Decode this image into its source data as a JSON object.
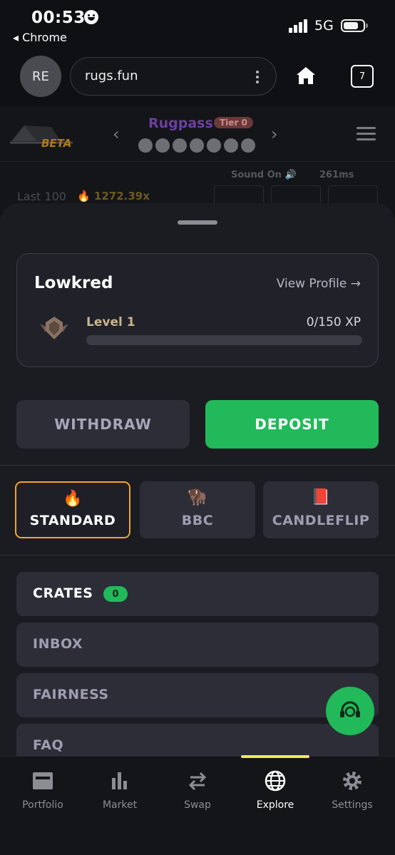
{
  "status_bar": {
    "time": "00:53",
    "back_app": "◂ Chrome",
    "network": "5G"
  },
  "browser": {
    "avatar": "RE",
    "url": "rugs.fun",
    "tab_count": "7"
  },
  "game_header": {
    "beta": "BETA",
    "rugpass": "Rugpass",
    "tier": "Tier 0",
    "sound": "Sound On 🔊",
    "ping": "261ms",
    "last_label": "Last 100",
    "multiplier": "🔥 1272.39x"
  },
  "profile": {
    "username": "Lowkred",
    "view_profile": "View Profile →",
    "level": "Level 1",
    "xp": "0/150 XP",
    "xp_progress": 0
  },
  "actions": {
    "withdraw": "WITHDRAW",
    "deposit": "DEPOSIT"
  },
  "modes": [
    {
      "emoji": "🔥",
      "label": "STANDARD",
      "active": true
    },
    {
      "emoji": "🦬",
      "label": "BBC",
      "active": false
    },
    {
      "emoji": "📕",
      "label": "CANDLEFLIP",
      "active": false
    }
  ],
  "menu": [
    {
      "label": "CRATES",
      "badge": "0"
    },
    {
      "label": "INBOX"
    },
    {
      "label": "FAIRNESS"
    },
    {
      "label": "FAQ"
    }
  ],
  "nav": [
    {
      "label": "Portfolio",
      "icon": "portfolio-icon"
    },
    {
      "label": "Market",
      "icon": "bar-chart-icon"
    },
    {
      "label": "Swap",
      "icon": "swap-arrows-icon"
    },
    {
      "label": "Explore",
      "icon": "globe-icon",
      "active": true
    },
    {
      "label": "Settings",
      "icon": "gear-icon"
    }
  ],
  "colors": {
    "accent_green": "#21b95a",
    "active_border": "#f0a62a",
    "nav_indicator": "#f6e85a"
  }
}
